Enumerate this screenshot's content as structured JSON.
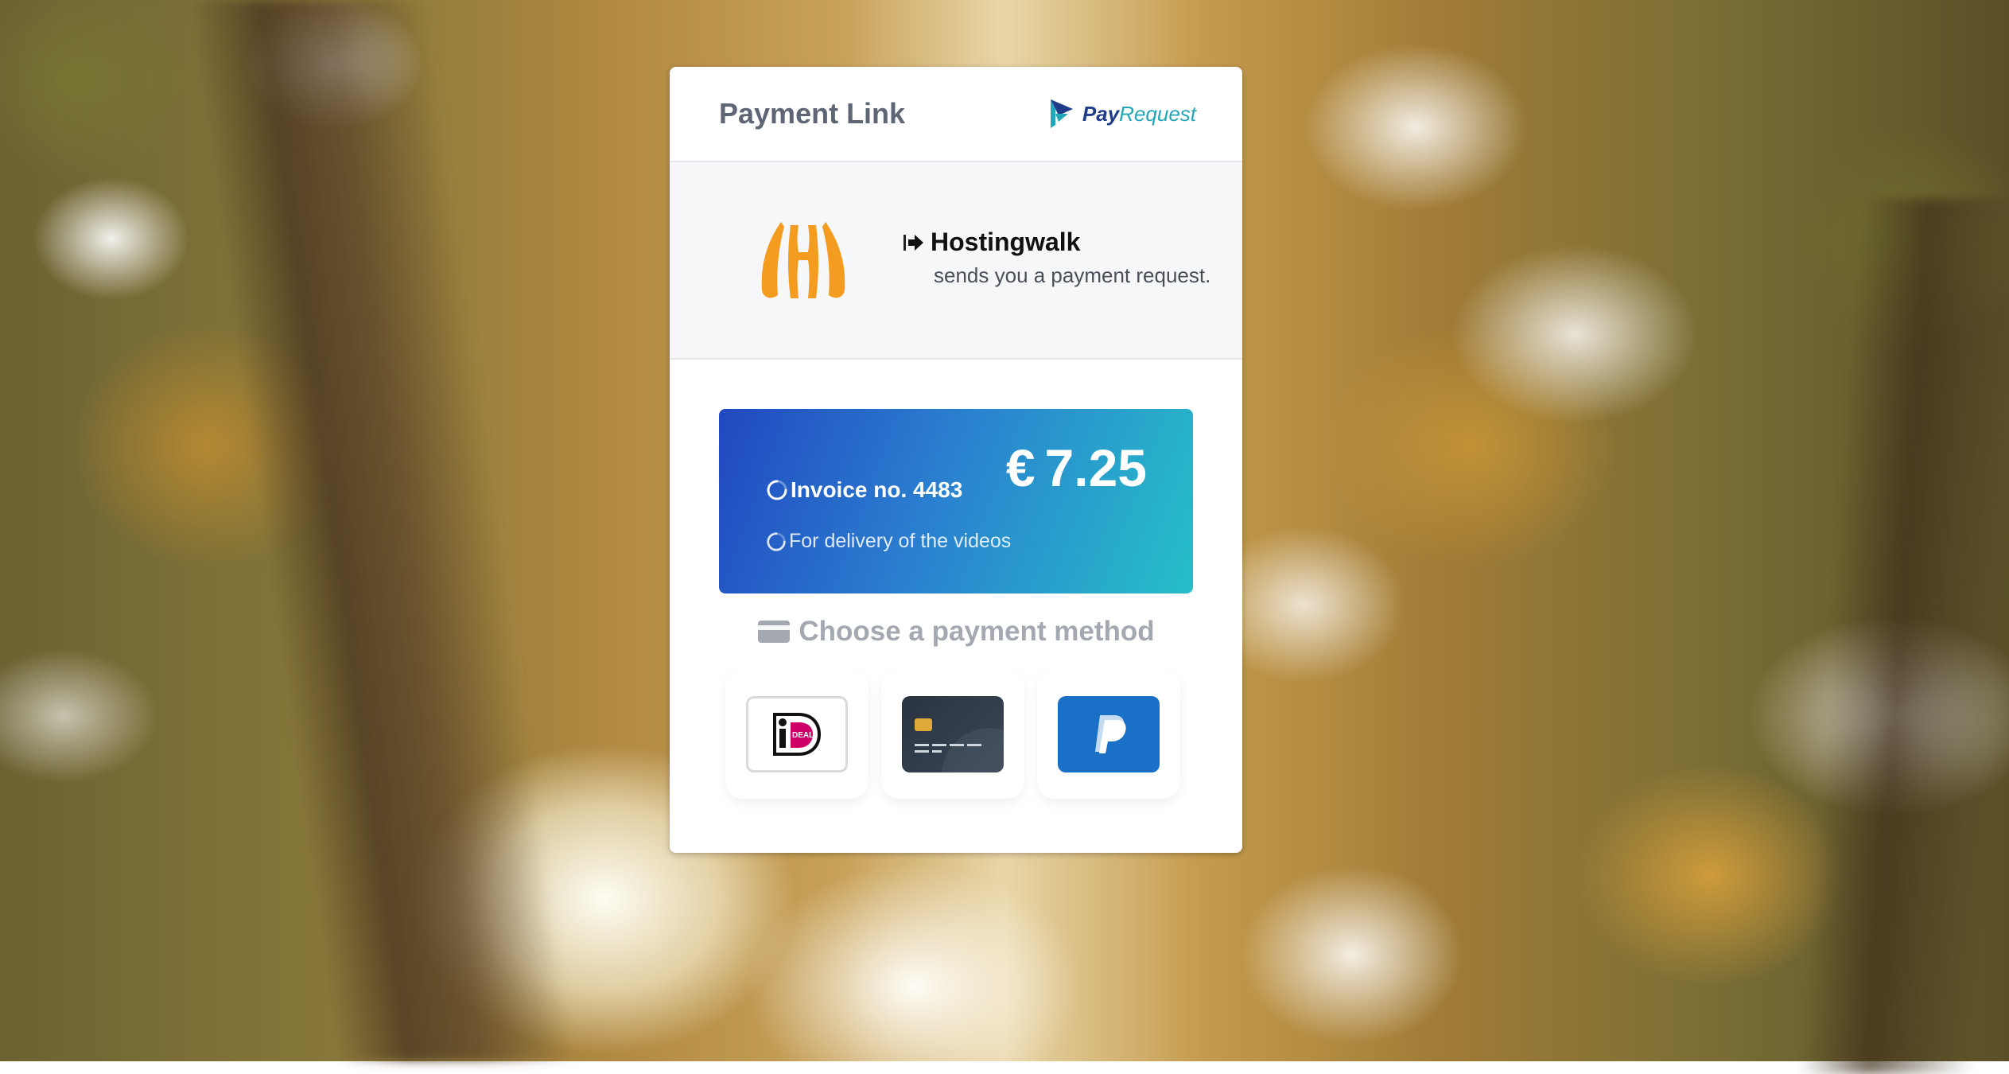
{
  "header": {
    "title": "Payment Link",
    "brand_pay": "Pay",
    "brand_request": "Request"
  },
  "merchant": {
    "name": "Hostingwalk",
    "subtitle": "sends you a payment request."
  },
  "invoice": {
    "number": "Invoice no. 4483",
    "description": "For delivery of the videos",
    "currency": "€",
    "amount": "7.25"
  },
  "payment": {
    "heading": "Choose a payment method",
    "methods": [
      {
        "name": "iDEAL",
        "icon": "ideal-icon"
      },
      {
        "name": "Credit card",
        "icon": "credit-card-icon"
      },
      {
        "name": "PayPal",
        "icon": "paypal-icon"
      }
    ]
  },
  "colors": {
    "brand_dark": "#1f3c88",
    "brand_teal": "#23a7b8",
    "merchant_orange": "#f39c1f",
    "gradient_start": "#2148c0",
    "gradient_end": "#26bfc8",
    "paypal_blue": "#1a6fc6"
  }
}
